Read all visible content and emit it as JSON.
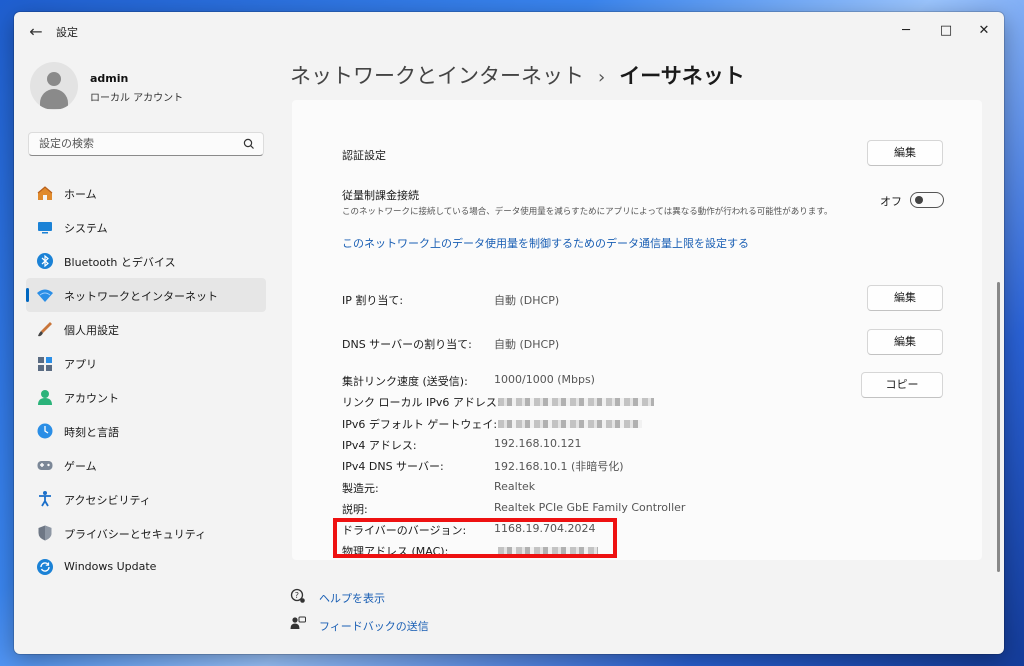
{
  "window": {
    "title": "設定",
    "back_icon": "back-arrow-icon",
    "minimize": "─",
    "maximize": "□",
    "close": "✕"
  },
  "profile": {
    "name": "admin",
    "type": "ローカル アカウント"
  },
  "search": {
    "placeholder": "設定の検索"
  },
  "sidebar": {
    "items": [
      {
        "label": "ホーム",
        "icon": "home-icon"
      },
      {
        "label": "システム",
        "icon": "system-icon"
      },
      {
        "label": "Bluetooth とデバイス",
        "icon": "bluetooth-icon"
      },
      {
        "label": "ネットワークとインターネット",
        "icon": "network-icon",
        "active": true
      },
      {
        "label": "個人用設定",
        "icon": "personalization-icon"
      },
      {
        "label": "アプリ",
        "icon": "apps-icon"
      },
      {
        "label": "アカウント",
        "icon": "account-icon"
      },
      {
        "label": "時刻と言語",
        "icon": "time-language-icon"
      },
      {
        "label": "ゲーム",
        "icon": "gaming-icon"
      },
      {
        "label": "アクセシビリティ",
        "icon": "accessibility-icon"
      },
      {
        "label": "プライバシーとセキュリティ",
        "icon": "privacy-icon"
      },
      {
        "label": "Windows Update",
        "icon": "windows-update-icon"
      }
    ]
  },
  "breadcrumb": {
    "parent": "ネットワークとインターネット",
    "separator": "›",
    "current": "イーサネット"
  },
  "settings": {
    "auth": {
      "label": "認証設定",
      "button": "編集"
    },
    "metered": {
      "label": "従量制課金接続",
      "desc": "このネットワークに接続している場合、データ使用量を減らすためにアプリによっては異なる動作が行われる可能性があります。",
      "toggle_label": "オフ"
    },
    "data_limit_link": "このネットワーク上のデータ使用量を制御するためのデータ通信量上限を設定する",
    "ip_assign": {
      "label": "IP 割り当て:",
      "value": "自動 (DHCP)",
      "button": "編集"
    },
    "dns_assign": {
      "label": "DNS サーバーの割り当て:",
      "value": "自動 (DHCP)",
      "button": "編集"
    },
    "copy_button": "コピー",
    "properties": [
      {
        "label": "集計リンク速度 (送受信):",
        "value": "1000/1000 (Mbps)"
      },
      {
        "label": "リンク ローカル IPv6 アドレス:",
        "value": ""
      },
      {
        "label": "IPv6 デフォルト ゲートウェイ:",
        "value": ""
      },
      {
        "label": "IPv4 アドレス:",
        "value": "192.168.10.121"
      },
      {
        "label": "IPv4 DNS サーバー:",
        "value": "192.168.10.1 (非暗号化)"
      },
      {
        "label": "製造元:",
        "value": "Realtek"
      },
      {
        "label": "説明:",
        "value": "Realtek PCIe GbE Family Controller"
      },
      {
        "label": "ドライバーのバージョン:",
        "value": "1168.19.704.2024"
      },
      {
        "label": "物理アドレス (MAC):",
        "value": ""
      }
    ]
  },
  "footer": {
    "help": "ヘルプを表示",
    "feedback": "フィードバックの送信"
  },
  "colors": {
    "accent": "#0067c0",
    "highlight": "#ee1111",
    "link": "#1a5fb4"
  }
}
